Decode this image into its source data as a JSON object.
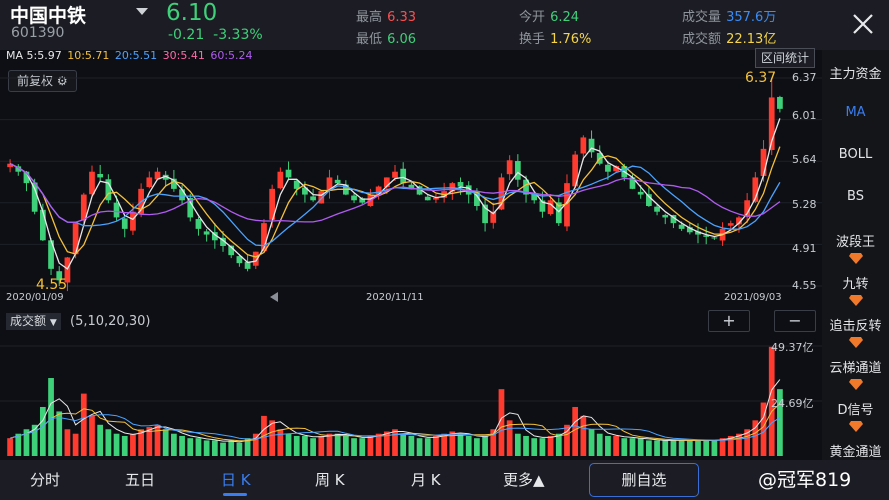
{
  "stock": {
    "name": "中国中铁",
    "code": "601390",
    "price": "6.10",
    "change": "-0.21",
    "change_pct": "-3.33%"
  },
  "quote": [
    {
      "label": "最高",
      "value": "6.33",
      "color": "#ff4d4f"
    },
    {
      "label": "最低",
      "value": "6.06",
      "color": "#3fd07a"
    },
    {
      "label": "今开",
      "value": "6.24",
      "color": "#3fd07a"
    },
    {
      "label": "换手",
      "value": "1.76%",
      "color": "#f5d547"
    },
    {
      "label": "成交量",
      "value": "357.6万",
      "color": "#3a8df5"
    },
    {
      "label": "成交额",
      "value": "22.13亿",
      "color": "#f5d547"
    }
  ],
  "ma_legend": [
    {
      "text": "MA 5:5.97",
      "color": "#e8e8e8"
    },
    {
      "text": "10:5.71",
      "color": "#f5c13a"
    },
    {
      "text": "20:5.51",
      "color": "#4aa3ff"
    },
    {
      "text": "30:5.41",
      "color": "#ff6aa8"
    },
    {
      "text": "60:5.24",
      "color": "#b05cf0"
    }
  ],
  "chart": {
    "adjust_label": "前复权",
    "range_label": "区间统计",
    "max_label": "6.37",
    "min_label": "4.55"
  },
  "chart_data": {
    "type": "candlestick",
    "y_ticks": [
      "6.37",
      "6.01",
      "5.64",
      "5.28",
      "4.91",
      "4.55"
    ],
    "ylim": [
      4.55,
      6.37
    ],
    "x_labels": [
      "2020/01/09",
      "2020/11/11",
      "2021/09/03"
    ],
    "high": 6.37,
    "low": 4.55,
    "close_series": [
      5.62,
      5.55,
      5.45,
      5.2,
      4.95,
      4.7,
      4.6,
      4.8,
      5.1,
      5.35,
      5.55,
      5.5,
      5.3,
      5.15,
      5.05,
      5.2,
      5.4,
      5.5,
      5.55,
      5.48,
      5.4,
      5.3,
      5.15,
      5.05,
      5.0,
      4.95,
      4.9,
      4.82,
      4.75,
      4.7,
      4.85,
      5.1,
      5.4,
      5.55,
      5.5,
      5.4,
      5.35,
      5.3,
      5.38,
      5.5,
      5.45,
      5.35,
      5.3,
      5.28,
      5.35,
      5.42,
      5.5,
      5.55,
      5.45,
      5.4,
      5.35,
      5.3,
      5.32,
      5.38,
      5.45,
      5.42,
      5.35,
      5.25,
      5.1,
      5.2,
      5.5,
      5.65,
      5.48,
      5.35,
      5.3,
      5.2,
      5.3,
      5.1,
      5.45,
      5.7,
      5.85,
      5.72,
      5.62,
      5.55,
      5.6,
      5.5,
      5.4,
      5.35,
      5.25,
      5.2,
      5.15,
      5.1,
      5.05,
      5.02,
      5.0,
      4.98,
      4.97,
      5.05,
      5.1,
      5.15,
      5.3,
      5.5,
      5.75,
      6.2,
      6.1
    ],
    "volume": {
      "label": "成交额",
      "params": "(5,10,20,30)",
      "tick_high": "49.37亿",
      "tick_mid": "24.69亿",
      "values": [
        8,
        10,
        12,
        14,
        22,
        35,
        20,
        12,
        10,
        28,
        18,
        14,
        12,
        10,
        9,
        10,
        12,
        13,
        14,
        12,
        10,
        9,
        8,
        8,
        7,
        7,
        6,
        7,
        6,
        8,
        10,
        18,
        16,
        12,
        10,
        9,
        9,
        8,
        9,
        10,
        10,
        9,
        8,
        8,
        9,
        10,
        11,
        12,
        10,
        9,
        8,
        8,
        9,
        10,
        11,
        10,
        9,
        8,
        9,
        12,
        30,
        16,
        10,
        9,
        8,
        8,
        9,
        10,
        14,
        22,
        18,
        12,
        10,
        9,
        9,
        8,
        8,
        8,
        7,
        7,
        7,
        7,
        7,
        7,
        7,
        7,
        7,
        8,
        9,
        10,
        12,
        16,
        24,
        49,
        30
      ]
    }
  },
  "side_menu": [
    {
      "label": "主力资金"
    },
    {
      "label": "MA"
    },
    {
      "label": "BOLL"
    },
    {
      "label": "BS"
    },
    {
      "label": "波段王"
    },
    {
      "label": "九转"
    },
    {
      "label": "追击反转"
    },
    {
      "label": "云梯通道"
    },
    {
      "label": "D信号"
    },
    {
      "label": "黄金通道"
    }
  ],
  "vol_buttons": {
    "plus": "+",
    "minus": "−"
  },
  "bottom_nav": [
    {
      "label": "分时"
    },
    {
      "label": "五日"
    },
    {
      "label": "日 K"
    },
    {
      "label": "周 K"
    },
    {
      "label": "月 K"
    },
    {
      "label": "更多▲"
    }
  ],
  "delete_label": "删自选",
  "watermark": "@冠军819",
  "colors": {
    "up": "#ff3b30",
    "down": "#3fd07a",
    "accent": "#3a7df0",
    "ma5": "#e8e8e8",
    "ma10": "#f5c13a",
    "ma20": "#4aa3ff",
    "ma60": "#b05cf0"
  }
}
